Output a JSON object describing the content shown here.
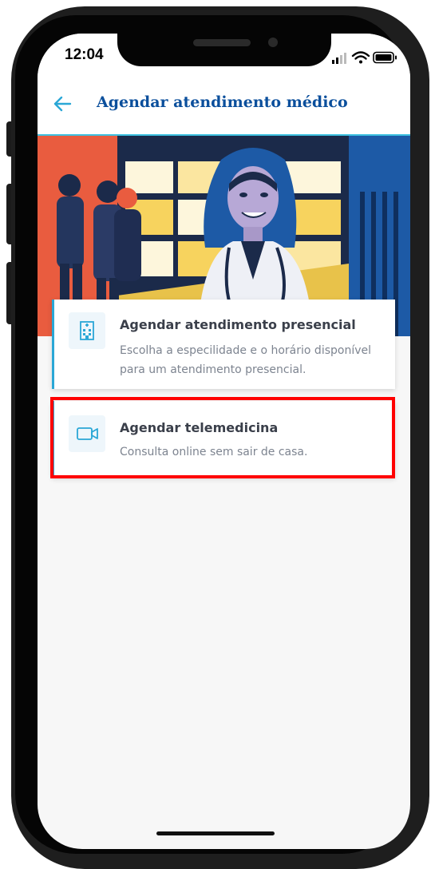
{
  "status_bar": {
    "time": "12:04"
  },
  "header": {
    "title": "Agendar atendimento médico"
  },
  "options": [
    {
      "title": "Agendar atendimento presencial",
      "description_line1": "Escolha a especilidade e o horário disponível",
      "description_line2": "para um atendimento presencial.",
      "icon": "hospital-building-icon"
    },
    {
      "title": "Agendar telemedicina",
      "description_line1": "Consulta online sem sair de casa.",
      "icon": "video-camera-icon"
    }
  ],
  "colors": {
    "title": "#0b4f9c",
    "accent": "#2aa7d6",
    "highlight": "#ff0000",
    "hero_red": "#e95c3f",
    "hero_blue": "#1d5aa6",
    "hero_navy": "#1b2a4a",
    "hero_yellow": "#f7d35e"
  }
}
